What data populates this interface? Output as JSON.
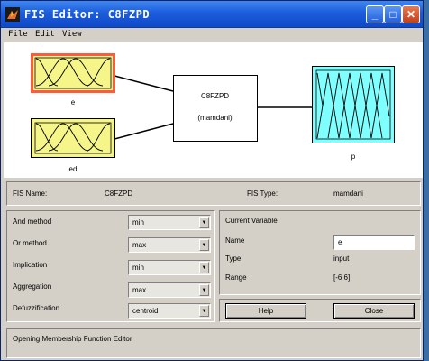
{
  "window": {
    "title": "FIS Editor: C8FZPD",
    "minimize_symbol": "_",
    "maximize_symbol": "□",
    "close_symbol": "✕"
  },
  "menu": [
    "File",
    "Edit",
    "View"
  ],
  "diagram": {
    "inputs": [
      {
        "label": "e",
        "selected": true,
        "fill": "#f5f58a"
      },
      {
        "label": "ed",
        "selected": false,
        "fill": "#f5f58a"
      }
    ],
    "rule_block": {
      "name": "C8FZPD",
      "type": "(mamdani)"
    },
    "output": {
      "label": "p",
      "fill": "#80ffff"
    },
    "selection_color": "#ff5a3a"
  },
  "fis_info": {
    "name_label": "FIS Name:",
    "name_value": "C8FZPD",
    "type_label": "FIS Type:",
    "type_value": "mamdani"
  },
  "methods": [
    {
      "label": "And method",
      "value": "min"
    },
    {
      "label": "Or method",
      "value": "max"
    },
    {
      "label": "Implication",
      "value": "min"
    },
    {
      "label": "Aggregation",
      "value": "max"
    },
    {
      "label": "Defuzzification",
      "value": "centroid"
    }
  ],
  "current_variable": {
    "heading": "Current Variable",
    "name_label": "Name",
    "name_value": "e",
    "type_label": "Type",
    "type_value": "input",
    "range_label": "Range",
    "range_value": "[-6 6]"
  },
  "buttons": {
    "help": "Help",
    "close": "Close"
  },
  "status": "Opening Membership Function Editor"
}
